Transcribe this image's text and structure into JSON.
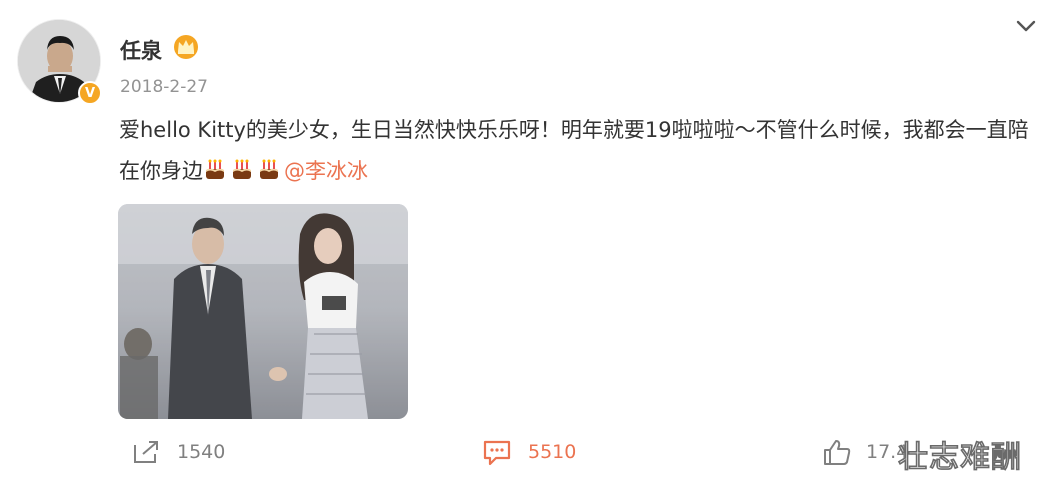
{
  "post": {
    "username": "任泉",
    "date": "2018-2-27",
    "text_main": "爱hello Kitty的美少女，生日当然快快乐乐呀！明年就要19啦啦啦～不管什么时候，我都会一直陪在你身边",
    "mention": "@李冰冰",
    "emoji_icons": [
      "cake-icon",
      "cake-icon",
      "cake-icon"
    ],
    "badges": {
      "verified_icon": "verified-icon",
      "member_icon": "crown-icon"
    }
  },
  "actions": {
    "repost_count": "1540",
    "comment_count": "5510",
    "like_count": "17.4"
  },
  "watermark": "壮志难酬",
  "colors": {
    "accent_orange": "#eb7350",
    "badge_gold": "#f5a623",
    "muted_gray": "#939393"
  }
}
